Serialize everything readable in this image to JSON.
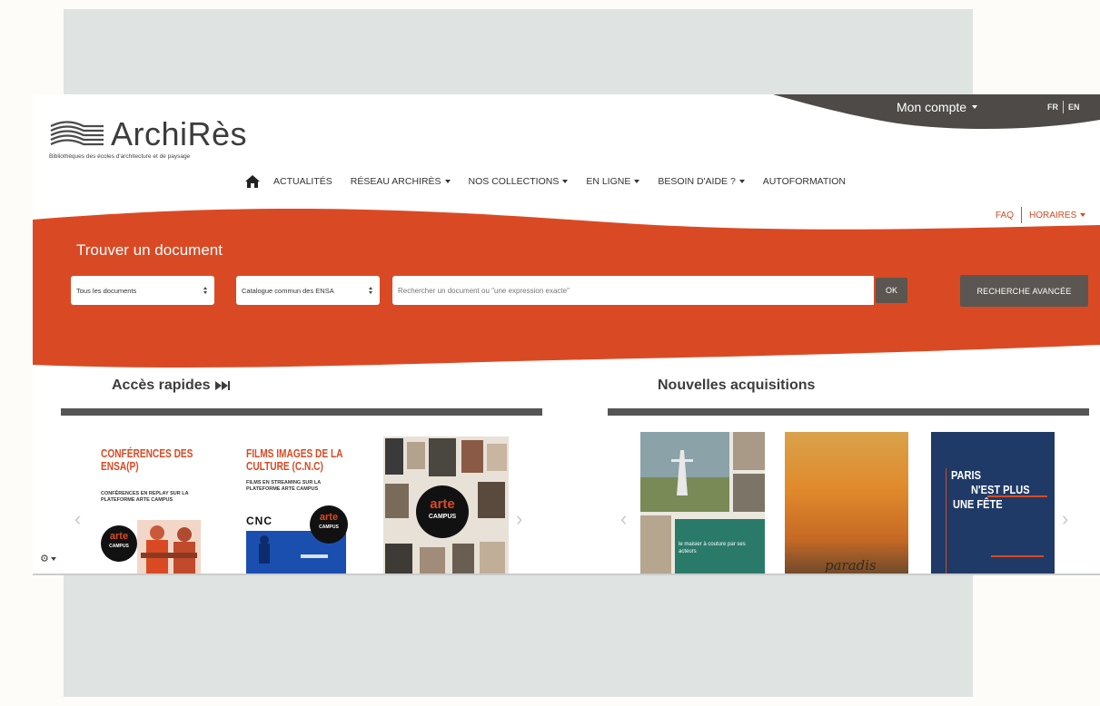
{
  "header": {
    "account_label": "Mon compte",
    "lang_fr": "FR",
    "lang_en": "EN"
  },
  "logo": {
    "name": "ArchiRès",
    "tagline": "Bibliothèques des écoles d'architecture et de paysage"
  },
  "nav": {
    "items": [
      {
        "label": "ACTUALITÉS",
        "dropdown": false
      },
      {
        "label": "RÉSEAU ARCHIRÈS",
        "dropdown": true
      },
      {
        "label": "NOS COLLECTIONS",
        "dropdown": true
      },
      {
        "label": "EN LIGNE",
        "dropdown": true
      },
      {
        "label": "BESOIN D'AIDE ?",
        "dropdown": true
      },
      {
        "label": "AUTOFORMATION",
        "dropdown": false
      }
    ]
  },
  "sublinks": {
    "faq": "FAQ",
    "horaires": "HORAIRES"
  },
  "search": {
    "title": "Trouver un document",
    "doc_type_selected": "Tous les documents",
    "catalog_selected": "Catalogue commun des ENSA",
    "placeholder": "Rechercher un document ou \"une expression exacte\"",
    "ok_label": "OK",
    "advanced_label": "RECHERCHE AVANCÉE"
  },
  "quick_access": {
    "title": "Accès rapides",
    "cards": [
      {
        "title": "CONFÉRENCES DES ENSA(P)",
        "subtitle": "CONFÉRENCES EN REPLAY SUR LA PLATEFORME ARTE CAMPUS",
        "badge_top": "arte",
        "badge_bottom": "CAMPUS"
      },
      {
        "title": "FILMS IMAGES DE LA CULTURE (C.N.C)",
        "subtitle": "FILMS EN STREAMING SUR LA PLATEFORME ARTE CAMPUS",
        "logo": "CNC",
        "badge_top": "arte",
        "badge_bottom": "CAMPUS"
      },
      {
        "badge_top": "arte",
        "badge_bottom": "CAMPUS"
      }
    ]
  },
  "new_acquisitions": {
    "title": "Nouvelles acquisitions",
    "books": [
      {
        "cover_text": "le maisier à couture par ses acteurs"
      },
      {
        "cover_text": "paradis"
      },
      {
        "line1": "PARIS",
        "line2": "N'EST PLUS",
        "line3": "UNE FÊTE"
      }
    ]
  },
  "colors": {
    "accent": "#d94a24",
    "dark": "#5b5651",
    "swoosh": "#4d4a47"
  }
}
